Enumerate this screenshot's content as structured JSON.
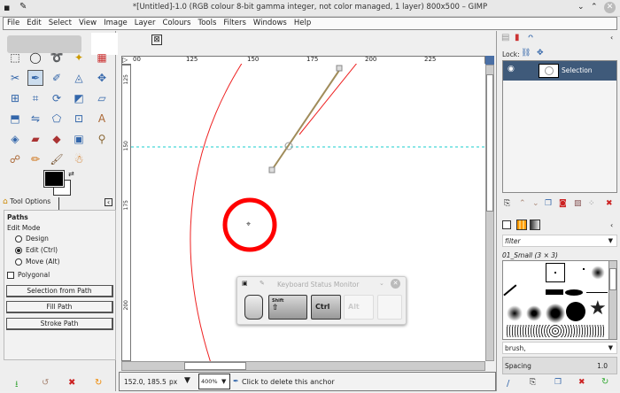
{
  "window": {
    "title": "*[Untitled]-1.0 (RGB colour 8-bit gamma integer, not color managed, 1 layer) 800x500 – GIMP"
  },
  "menu": [
    "File",
    "Edit",
    "Select",
    "View",
    "Image",
    "Layer",
    "Colours",
    "Tools",
    "Filters",
    "Windows",
    "Help"
  ],
  "tool_options": {
    "tab": "Tool Options",
    "heading": "Paths",
    "edit_mode_label": "Edit Mode",
    "modes": [
      "Design",
      "Edit (Ctrl)",
      "Move (Alt)"
    ],
    "selected_mode": "Edit (Ctrl)",
    "polygonal": "Polygonal",
    "buttons": [
      "Selection from Path",
      "Fill Path",
      "Stroke Path"
    ]
  },
  "rulers": {
    "h": [
      "00",
      "125",
      "150",
      "175",
      "200",
      "225"
    ],
    "v": [
      "125",
      "150",
      "175",
      "200"
    ]
  },
  "layers": {
    "lock_label": "Lock:",
    "items": [
      {
        "name": "Selection",
        "visible": true
      }
    ]
  },
  "brushes": {
    "filter_placeholder": "filter",
    "current": "01_Small (3 × 3)",
    "tag": "brush,",
    "spacing_label": "Spacing",
    "spacing_value": "1.0"
  },
  "key_monitor": {
    "title": "Keyboard Status Monitor",
    "keys": [
      "Shift",
      "Ctrl",
      "Alt",
      ""
    ],
    "active": [
      "Shift",
      "Ctrl"
    ]
  },
  "status": {
    "coords": "152.0, 185.5",
    "unit": "px",
    "zoom": "400%",
    "message": "Click to delete this anchor"
  },
  "colors": {
    "accent": "#3f5a7a",
    "highlight_circle": "#ff0000",
    "path": "#a08c5a"
  }
}
